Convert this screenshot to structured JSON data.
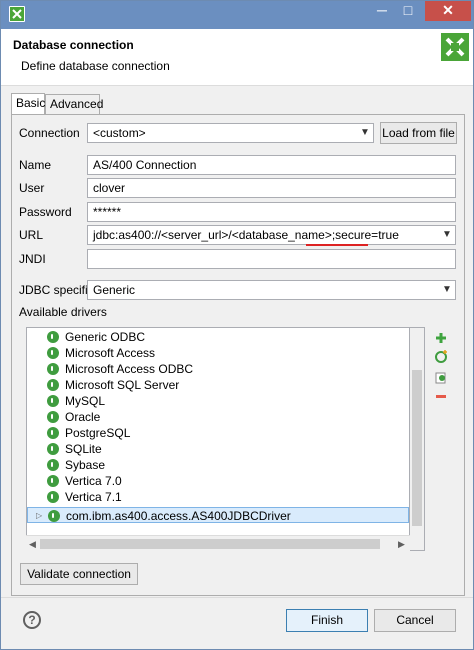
{
  "window": {
    "title_buttons": {
      "minimize": "─",
      "maximize": "□",
      "close": "✕"
    },
    "app_icon": "x-app-icon"
  },
  "header": {
    "title": "Database connection",
    "subtitle": "Define database connection",
    "logo": "cloveretl-logo"
  },
  "tabs": [
    "Basic",
    "Advanced"
  ],
  "form": {
    "connection_label": "Connection",
    "connection_value": "<custom>",
    "load_from_file": "Load from file",
    "name_label": "Name",
    "name_value": "AS/400 Connection",
    "user_label": "User",
    "user_value": "clover",
    "password_label": "Password",
    "password_value": "******",
    "url_label": "URL",
    "url_value_main": "jdbc:as400://<server_url>/<database_name>",
    "url_value_tail": ";secure=true",
    "jndi_label": "JNDI",
    "jndi_value": "",
    "jdbc_label": "JDBC specific",
    "jdbc_value": "Generic",
    "drivers_label": "Available drivers"
  },
  "drivers": [
    "Generic ODBC",
    "Microsoft Access",
    "Microsoft Access ODBC",
    "Microsoft SQL Server",
    "MySQL",
    "Oracle",
    "PostgreSQL",
    "SQLite",
    "Sybase",
    "Vertica 7.0",
    "Vertica 7.1",
    "com.ibm.as400.access.AS400JDBCDriver"
  ],
  "selected_driver_index": 11,
  "buttons": {
    "validate": "Validate connection",
    "finish": "Finish",
    "cancel": "Cancel",
    "help": "?"
  },
  "colors": {
    "accent": "#6b8fc0",
    "driver_icon": "#3f9c3f",
    "close": "#c7504a",
    "logo": "#4aa538"
  }
}
